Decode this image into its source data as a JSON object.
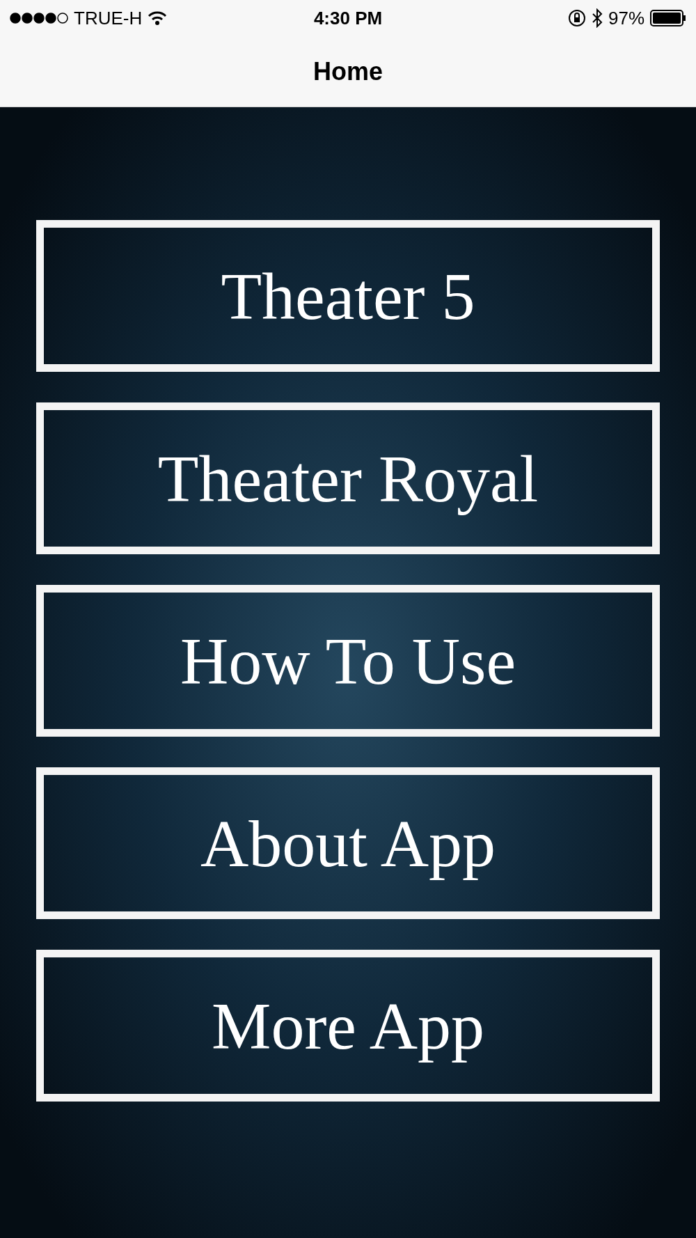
{
  "status_bar": {
    "carrier": "TRUE-H",
    "time": "4:30 PM",
    "battery": "97%"
  },
  "nav_bar": {
    "title": "Home"
  },
  "menu": [
    {
      "label": "Theater 5"
    },
    {
      "label": "Theater Royal"
    },
    {
      "label": "How To Use"
    },
    {
      "label": "About App"
    },
    {
      "label": "More App"
    }
  ]
}
